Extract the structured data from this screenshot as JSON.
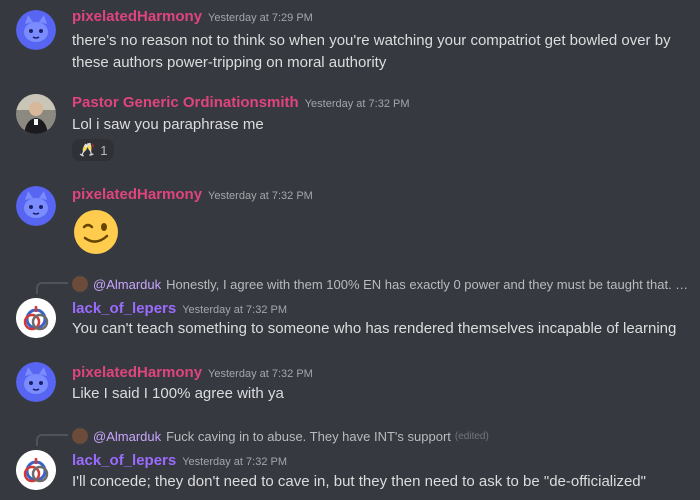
{
  "messages": [
    {
      "user": "pixelatedHarmony",
      "timestamp": "Yesterday at 7:29 PM",
      "color": "#e0447e",
      "lines": [
        "there's no reason not to think so when you're watching your compatriot get bowled over by",
        "these authors power-tripping on moral authority"
      ]
    },
    {
      "user": "Pastor Generic Ordinationsmith",
      "timestamp": "Yesterday at 7:32 PM",
      "color": "#e0447e",
      "lines": [
        "Lol i saw you paraphrase me"
      ],
      "reaction": {
        "emoji": "🥂",
        "count": "1"
      }
    },
    {
      "user": "pixelatedHarmony",
      "timestamp": "Yesterday at 7:32 PM",
      "color": "#e0447e",
      "emoji": "winking-face"
    },
    {
      "reply": {
        "mention": "@Almarduk",
        "text": "Honestly, I agree with them 100% EN has exactly 0 power and they must be taught that. Tra..."
      },
      "user": "lack_of_lepers",
      "timestamp": "Yesterday at 7:32 PM",
      "color": "#9b6bff",
      "lines": [
        "You can't teach something to someone who has rendered themselves incapable of learning"
      ]
    },
    {
      "user": "pixelatedHarmony",
      "timestamp": "Yesterday at 7:32 PM",
      "color": "#e0447e",
      "lines": [
        "Like I said I 100% agree with ya"
      ]
    },
    {
      "reply": {
        "mention": "@Almarduk",
        "text": "Fuck caving in to abuse. They have INT's support",
        "edited": "(edited)"
      },
      "user": "lack_of_lepers",
      "timestamp": "Yesterday at 7:32 PM",
      "color": "#9b6bff",
      "lines": [
        "I'll concede; they don't need to cave in, but they then need to ask to be \"de-officialized\""
      ]
    }
  ]
}
